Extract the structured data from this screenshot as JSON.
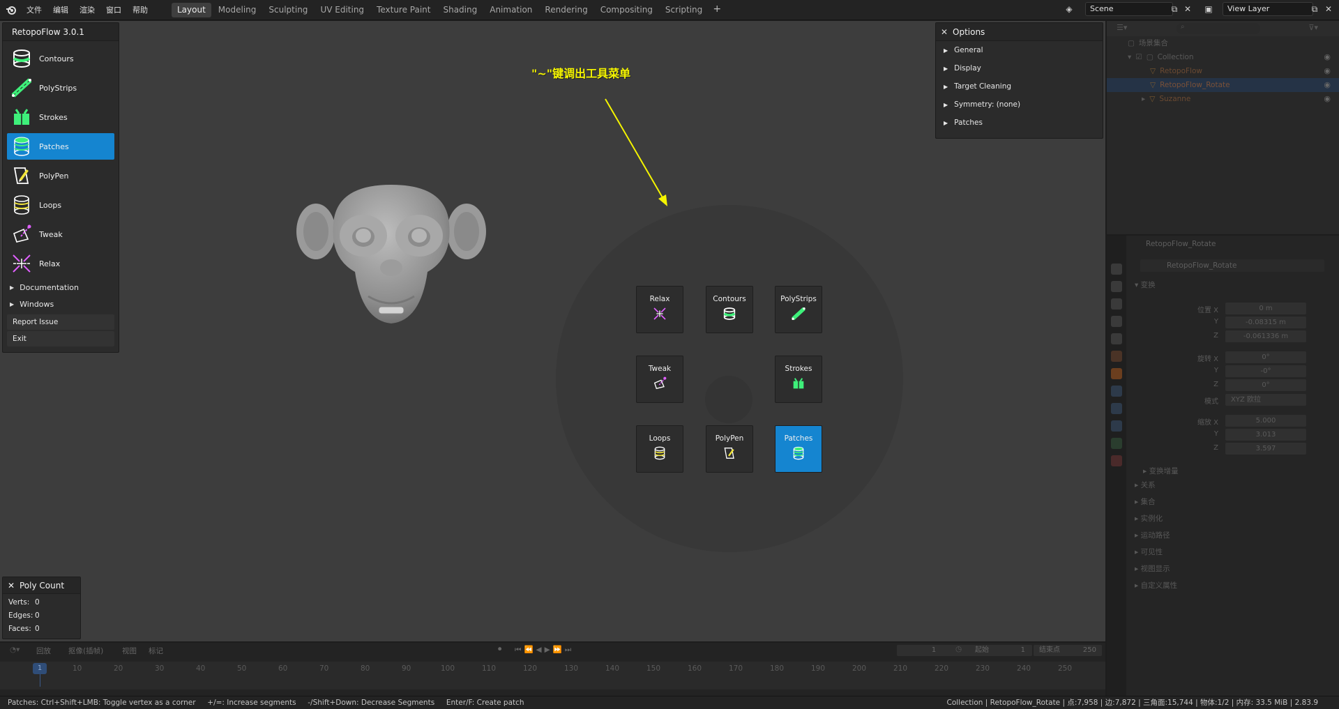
{
  "menu": [
    "文件",
    "编辑",
    "渲染",
    "窗口",
    "帮助"
  ],
  "workspaces": [
    "Layout",
    "Modeling",
    "Sculpting",
    "UV Editing",
    "Texture Paint",
    "Shading",
    "Animation",
    "Rendering",
    "Compositing",
    "Scripting"
  ],
  "active_workspace": "Layout",
  "scene": "Scene",
  "view_layer": "View Layer",
  "retopoflow": {
    "title": "RetopoFlow 3.0.1",
    "tools": [
      {
        "label": "Contours",
        "icon": "contours-icon"
      },
      {
        "label": "PolyStrips",
        "icon": "polystrips-icon"
      },
      {
        "label": "Strokes",
        "icon": "strokes-icon"
      },
      {
        "label": "Patches",
        "icon": "patches-icon",
        "active": true
      },
      {
        "label": "PolyPen",
        "icon": "polypen-icon"
      },
      {
        "label": "Loops",
        "icon": "loops-icon"
      },
      {
        "label": "Tweak",
        "icon": "tweak-icon"
      },
      {
        "label": "Relax",
        "icon": "relax-icon"
      }
    ],
    "documentation": "Documentation",
    "windows": "Windows",
    "report_issue": "Report Issue",
    "exit": "Exit"
  },
  "options": {
    "title": "Options",
    "rows": [
      "General",
      "Display",
      "Target Cleaning",
      "Symmetry: (none)",
      "Patches"
    ]
  },
  "poly_count": {
    "title": "Poly Count",
    "verts_label": "Verts:",
    "verts": "0",
    "edges_label": "Edges:",
    "edges": "0",
    "faces_label": "Faces:",
    "faces": "0"
  },
  "annotation": "\"~\"键调出工具菜单",
  "pie_menu": {
    "relax": "Relax",
    "contours": "Contours",
    "polystrips": "PolyStrips",
    "tweak": "Tweak",
    "strokes": "Strokes",
    "loops": "Loops",
    "polypen": "PolyPen",
    "patches": "Patches"
  },
  "outliner": {
    "scene_collection": "场景集合",
    "collection": "Collection",
    "items": [
      "RetopoFlow",
      "RetopoFlow_Rotate",
      "Suzanne"
    ]
  },
  "properties": {
    "object_name": "RetopoFlow_Rotate",
    "object_field": "RetopoFlow_Rotate",
    "transform": "变换",
    "location_label": "位置 X",
    "loc": [
      "0 m",
      "-0.08315 m",
      "-0.061336 m"
    ],
    "rotation_label": "旋转 X",
    "rot": [
      "0°",
      "-0°",
      "0°"
    ],
    "mode_label": "模式",
    "mode": "XYZ 欧拉",
    "scale_label": "缩放 X",
    "scale": [
      "5.000",
      "3.013",
      "3.597"
    ],
    "y": "Y",
    "z": "Z",
    "delta": "变换增量",
    "sections": [
      "关系",
      "集合",
      "实例化",
      "运动路径",
      "可见性",
      "视图显示",
      "自定义属性"
    ]
  },
  "timeline": {
    "menus": [
      "回放",
      "抠像(插帧)",
      "视图",
      "标记"
    ],
    "current_frame": "1",
    "start_label": "起始",
    "start": "1",
    "end_label": "结束点",
    "end": "250",
    "ticks": [
      "1",
      "10",
      "20",
      "30",
      "40",
      "50",
      "60",
      "70",
      "80",
      "90",
      "100",
      "110",
      "120",
      "130",
      "140",
      "150",
      "160",
      "170",
      "180",
      "190",
      "200",
      "210",
      "220",
      "230",
      "240",
      "250"
    ]
  },
  "status": {
    "left": "Patches: Ctrl+Shift+LMB: Toggle vertex as a corner     +/=: Increase segments     -/Shift+Down: Decrease Segments     Enter/F: Create patch",
    "right": "Collection | RetopoFlow_Rotate | 点:7,958 | 边:7,872 | 三角面:15,744 | 物体:1/2 | 内存: 33.5 MiB | 2.83.9"
  },
  "colors": {
    "accent": "#1585d0",
    "annotation": "#f5f500",
    "tool_green": "#3ef07a"
  }
}
